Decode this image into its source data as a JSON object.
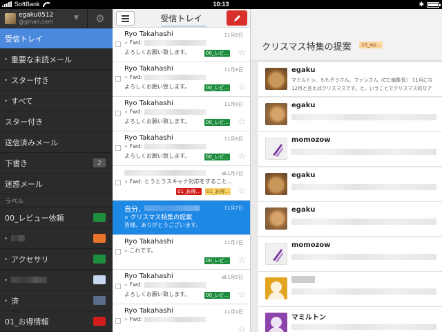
{
  "status_bar": {
    "carrier": "SoftBank",
    "time": "10:13",
    "bluetooth": "✱"
  },
  "account": {
    "username": "egaku0512",
    "email": "@gmail.com"
  },
  "sidebar": {
    "items": [
      {
        "label": "受信トレイ",
        "active": true,
        "dot": false
      },
      {
        "label": "重要な未読メール",
        "dot": true
      },
      {
        "label": "スター付き",
        "dot": true
      },
      {
        "label": "すべて",
        "dot": true
      },
      {
        "label": "スター付き",
        "dot": false
      },
      {
        "label": "送信済みメール",
        "dot": false
      },
      {
        "label": "下書き",
        "dot": false,
        "badge": "2"
      },
      {
        "label": "迷惑メール",
        "dot": false
      }
    ],
    "labels_heading": "ラベル",
    "labels": [
      {
        "label": "00_レビュー依頼",
        "color": "#1e8e3e"
      },
      {
        "label": "",
        "color": "#e8742b"
      },
      {
        "label": "アクセサリ",
        "color": "#1e8e3e"
      },
      {
        "label": "",
        "color": "#c7d8ef"
      },
      {
        "label": "済",
        "color": "#5b6c8a"
      },
      {
        "label": "01_お得情報",
        "color": "#d21d1d"
      }
    ]
  },
  "list": {
    "title": "受信トレイ",
    "messages": [
      {
        "sender": "Ryo Takahashi",
        "date": "11月8日",
        "subject": "Fwd:",
        "snippet": "よろしくお願い致します。",
        "label": "00_レビ...",
        "label_color": "#1e8e3e"
      },
      {
        "sender": "Ryo Takahashi",
        "date": "11月8日",
        "subject": "Fwd:",
        "snippet": "よろしくお願い致します。",
        "label": "00_レビ...",
        "label_color": "#1e8e3e"
      },
      {
        "sender": "Ryo Takahashi",
        "date": "11月8日",
        "subject": "Fwd:",
        "snippet": "よろしくお願い致します。",
        "label": "00_レビ...",
        "label_color": "#1e8e3e"
      },
      {
        "sender": "Ryo Takahashi",
        "date": "11月8日",
        "subject": "Fwd:",
        "snippet": "よろしくお願い致します。",
        "label": "00_レビ...",
        "label_color": "#1e8e3e"
      },
      {
        "sender": "",
        "date": "11月7日",
        "subject": "Fwd: とうとうスキャナ対応をすること...",
        "snippet": "",
        "label": "01_お得...",
        "label_color": "#d21d1d",
        "label2": "01_お得...",
        "label2_color": "#f6d36b"
      },
      {
        "sender": "自分、",
        "date": "11月7日",
        "subject": "クリスマス特集の提案",
        "snippet": "皆様、ありがとうございます。",
        "selected": true
      },
      {
        "sender": "Ryo Takahashi",
        "date": "11月7日",
        "subject": "これです。",
        "snippet": "",
        "label": "00_レビ...",
        "label_color": "#1e8e3e"
      },
      {
        "sender": "Ryo Takahashi",
        "date": "11月5日",
        "subject": "Fwd:",
        "snippet": "よろしくお願い致します。",
        "label": "00_レビ...",
        "label_color": "#1e8e3e"
      },
      {
        "sender": "Ryo Takahashi",
        "date": "11月4日",
        "subject": "Fwd:",
        "snippet": "",
        "label": "",
        "label_color": ""
      }
    ]
  },
  "reader": {
    "title": "クリスマス特集の提案",
    "tag": "10_Ap...",
    "conversation": [
      {
        "name": "egaku",
        "line1": "マミルトン、ももぞうさん、ファンさん（CC:編集長） 11月にな",
        "line2": "12月と言えばクリスマスです。と、いうことでクリスマス的なア"
      },
      {
        "name": "egaku"
      },
      {
        "name": "momozow"
      },
      {
        "name": "egaku"
      },
      {
        "name": "egaku"
      },
      {
        "name": "momozow"
      },
      {
        "name": ""
      },
      {
        "name": "マミルトン"
      }
    ]
  }
}
